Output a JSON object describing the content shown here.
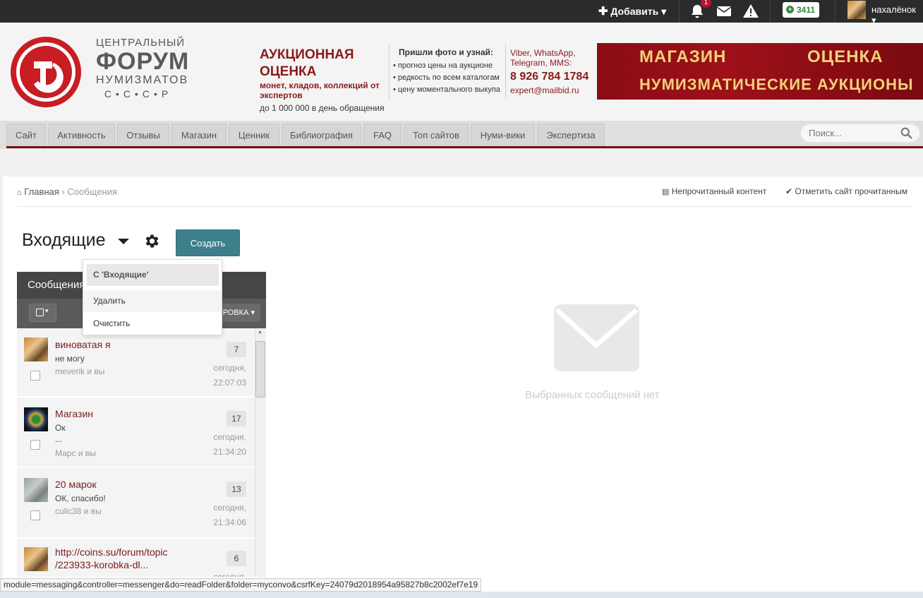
{
  "userbar": {
    "add_label": "Добавить",
    "notification_count": "1",
    "reputation": "3411",
    "username": "нахалёнок"
  },
  "logo": {
    "line1": "ЦЕНТРАЛЬНЫЙ",
    "line2": "ФОРУМ",
    "line3": "НУМИЗМАТОВ",
    "line4": "С•С•С•Р"
  },
  "ads": {
    "auction_title": "АУКЦИОННАЯ ОЦЕНКА",
    "auction_sub": "монет, кладов, коллекций от экспертов",
    "auction_note": "до 1 000 000 в день обращения",
    "send_title": "Пришли фото и узнай:",
    "send_items": [
      "прогноз цены на аукционе",
      "редкость по всем каталогам",
      "цену моментального выкупа"
    ],
    "contact_channels": "Viber, WhatsApp, Telegram, MMS:",
    "contact_phone": "8 926 784 1784",
    "contact_email": "expert@mailbid.ru",
    "banner_shop": "МАГАЗИН",
    "banner_eval": "ОЦЕНКА",
    "banner_auctions": "НУМИЗМАТИЧЕСКИЕ АУКЦИОНЫ"
  },
  "nav": {
    "tabs": [
      "Сайт",
      "Активность",
      "Отзывы",
      "Магазин",
      "Ценник",
      "Библиография",
      "FAQ",
      "Топ сайтов",
      "Нуми-вики",
      "Экспертиза"
    ],
    "search_placeholder": "Поиск..."
  },
  "breadcrumb": {
    "home": "Главная",
    "current": "Сообщения",
    "unread": "Непрочитанный контент",
    "mark_read": "Отметить сайт прочитанным"
  },
  "messenger": {
    "folder": "Входящие",
    "create_label": "Создать",
    "panel_title": "Сообщения",
    "sort_label": "РОВКА",
    "empty_text": "Выбранных сообщений нет"
  },
  "dropdown": {
    "header": "С 'Входящие'",
    "items": [
      "Удалить",
      "Очистить"
    ]
  },
  "conversations": [
    {
      "title": "виноватая я",
      "snippet": "не могу",
      "participants": "meverik и вы",
      "count": "7",
      "date1": "сегодня,",
      "date2": "22:07:03"
    },
    {
      "title": "Магазин",
      "snippet": "Ок",
      "snippet2": "...",
      "participants": "Марс и вы",
      "count": "17",
      "date1": "сегодня,",
      "date2": "21:34:20"
    },
    {
      "title": "20 марок",
      "snippet": "ОК, спасибо!",
      "participants": "culic38 и вы",
      "count": "13",
      "date1": "сегодня,",
      "date2": "21:34:06"
    },
    {
      "title": "http://coins.su/forum/topic",
      "title2": "/223933-korobka-dl...",
      "count": "6",
      "date1": "сегодня,"
    }
  ],
  "status_url": "module=messaging&controller=messenger&do=readFolder&folder=myconvo&csrfKey=24079d2018954a95827b8c2002ef7e19",
  "colors": {
    "accent": "#7a0e14",
    "button": "#3d7f8a",
    "link": "#7a1a1a"
  }
}
